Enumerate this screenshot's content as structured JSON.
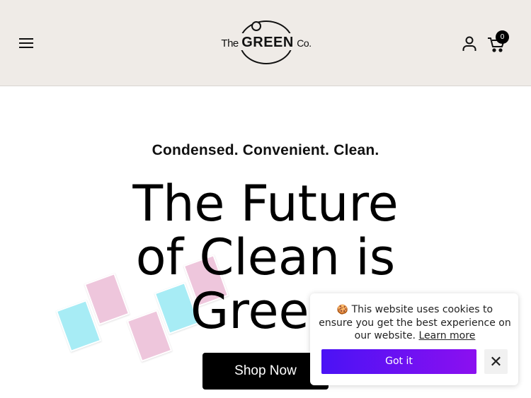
{
  "header": {
    "brand": {
      "the": "The",
      "green": "GREEN",
      "co": "Co."
    },
    "cart_count": "0",
    "icons": {
      "menu": "menu-icon",
      "account": "user-icon",
      "cart": "cart-icon"
    }
  },
  "hero": {
    "tagline": "Condensed. Convenient. Clean.",
    "headline_lines": [
      "The Future",
      "of Clean is",
      "Green"
    ],
    "cta_label": "Shop Now",
    "sheet_colors": {
      "blue": "#a7ecf5",
      "pink": "#eec6dc"
    }
  },
  "cookie_banner": {
    "emoji": "🍪",
    "message": "This website uses cookies to ensure you get the best experience on our website.",
    "link_text": "Learn more",
    "accept_label": "Got it",
    "close_icon": "close-icon",
    "accent_start": "#4a12f5",
    "accent_end": "#8c10f0"
  }
}
